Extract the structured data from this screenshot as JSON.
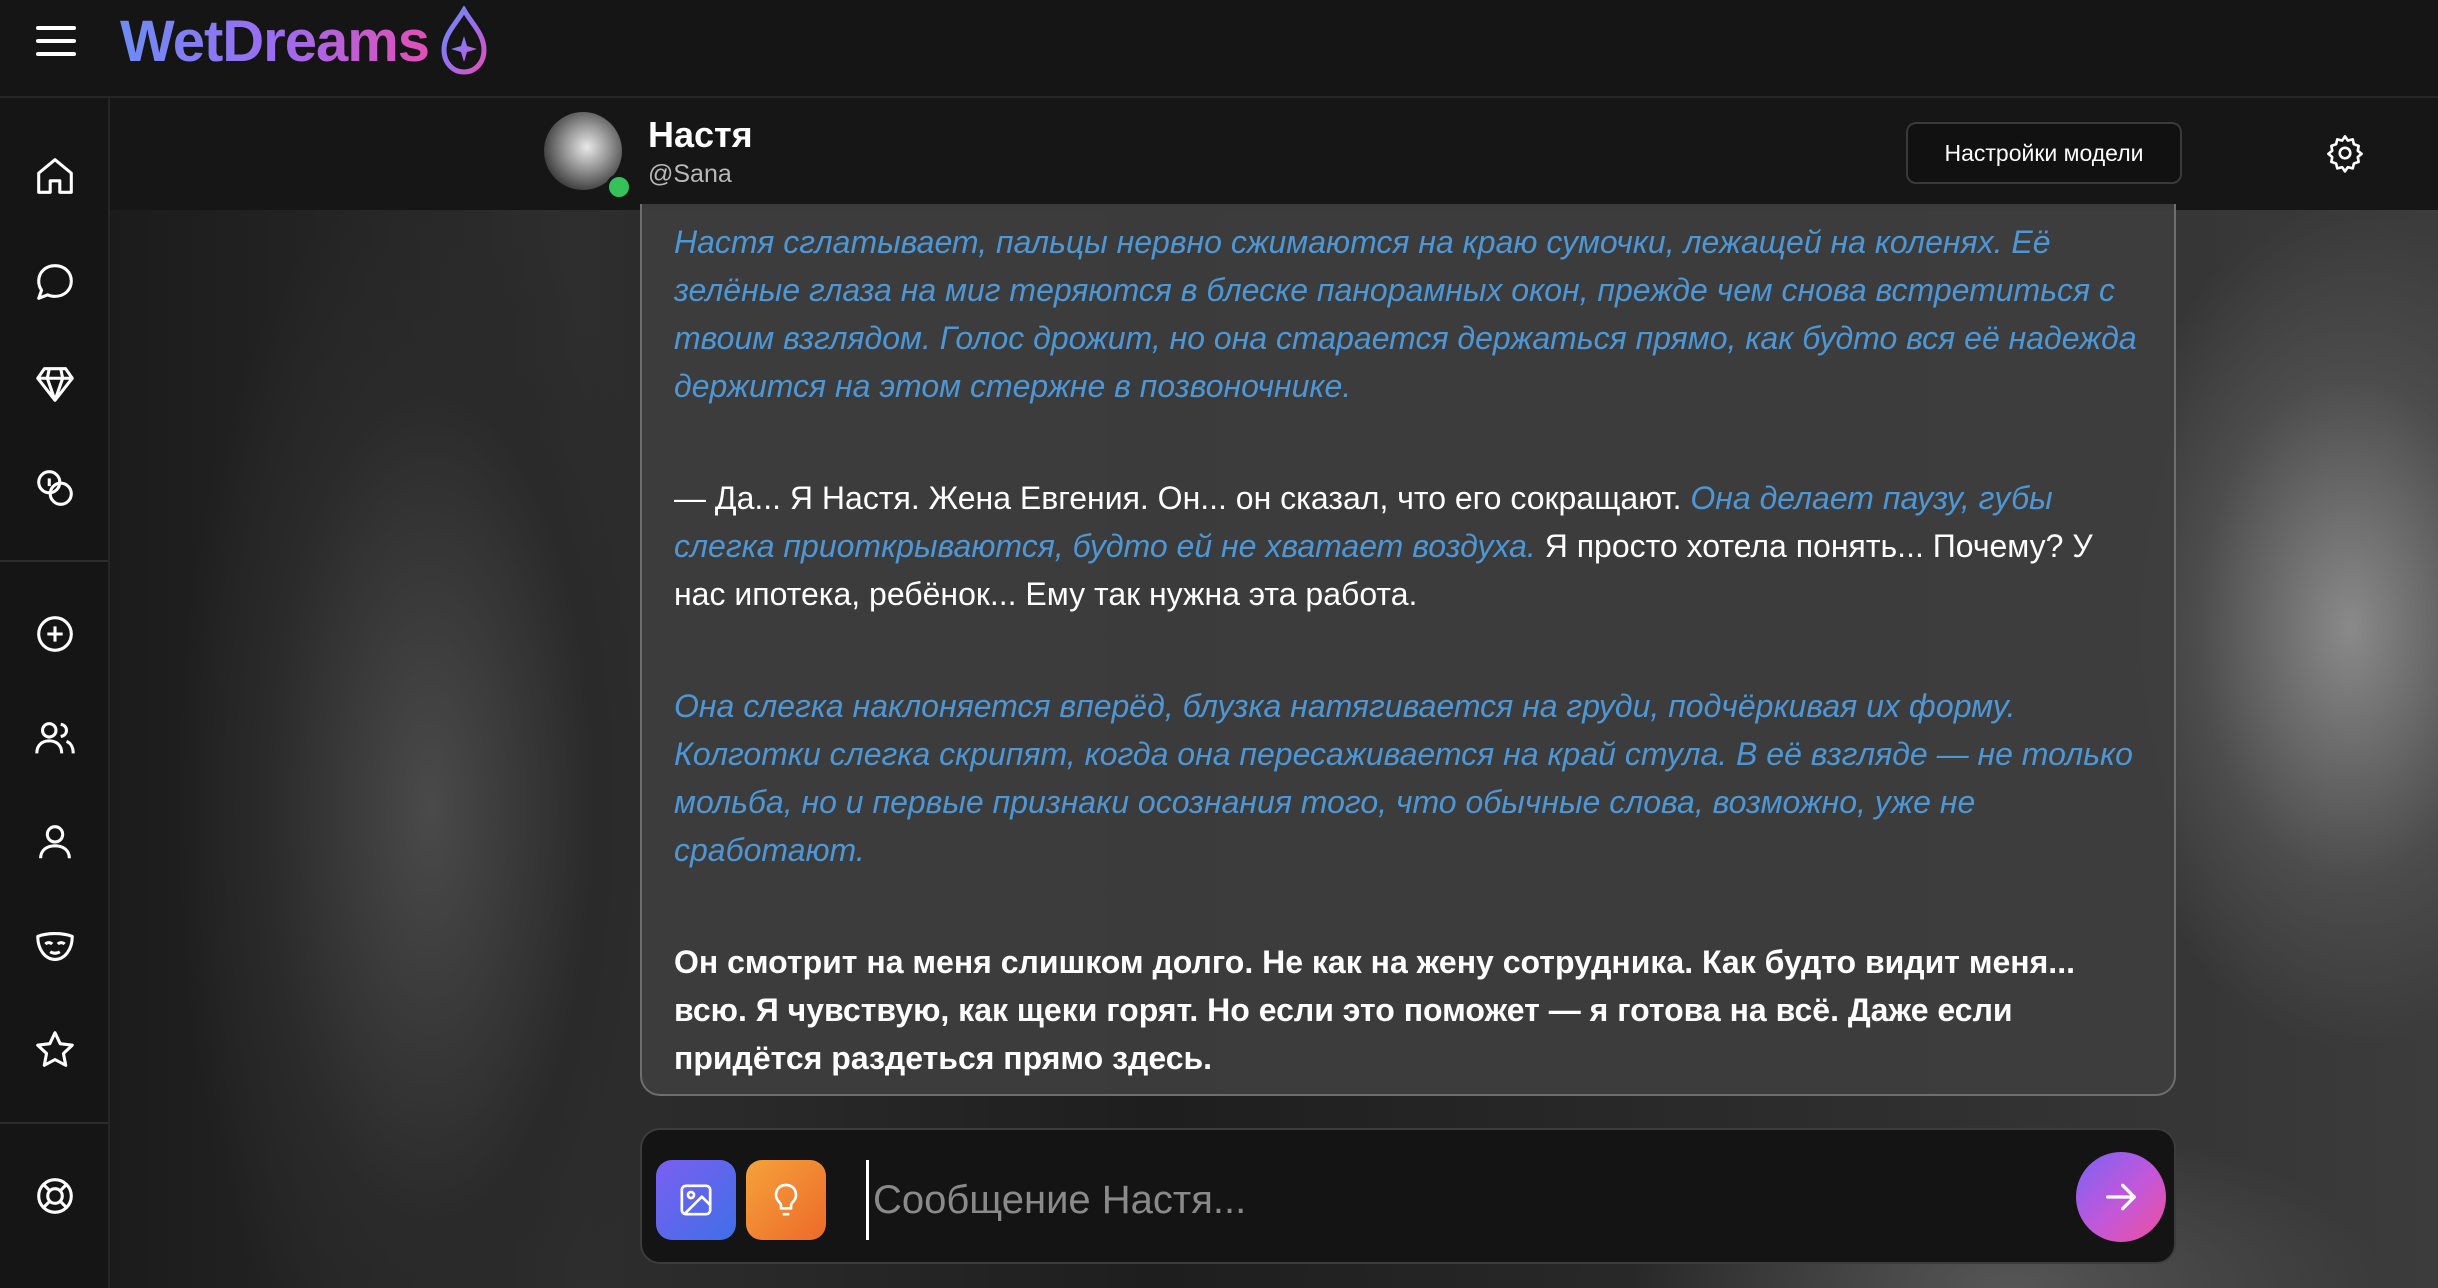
{
  "app": {
    "name": "WetDreams",
    "brand_gradient": [
      "#6e8cf3",
      "#9b6df0",
      "#e24fb5"
    ]
  },
  "topbar": {
    "menu_icon": "hamburger-menu-icon"
  },
  "sidebar": {
    "items": [
      {
        "id": "home",
        "icon": "home-icon"
      },
      {
        "id": "chats",
        "icon": "chat-bubble-icon"
      },
      {
        "id": "premium",
        "icon": "diamond-icon"
      },
      {
        "id": "coins",
        "icon": "coins-icon"
      },
      {
        "id": "create",
        "icon": "plus-circle-icon"
      },
      {
        "id": "community",
        "icon": "users-icon"
      },
      {
        "id": "profile",
        "icon": "user-icon"
      },
      {
        "id": "personas",
        "icon": "mask-icon"
      },
      {
        "id": "favorites",
        "icon": "star-icon"
      },
      {
        "id": "support",
        "icon": "lifebuoy-icon"
      }
    ]
  },
  "chat_header": {
    "name": "Настя",
    "handle": "@Sana",
    "online": true,
    "model_settings_label": "Настройки модели",
    "settings_icon": "gear-icon"
  },
  "message": {
    "p1": "Настя сглатывает, пальцы нервно сжимаются на краю сумочки, лежащей на коленях. Её зелёные глаза на миг теряются в блеске панорамных окон, прежде чем снова встретиться с твоим взглядом. Голос дрожит, но она старается держаться прямо, как будто вся её надежда держится на этом стержне в позвоночнике.",
    "p2_a": "— Да... Я Настя. Жена Евгения. Он... он сказал, что его сокращают.",
    "p2_b": "Она делает паузу, губы слегка приоткрываются, будто ей не хватает воздуха.",
    "p2_c": "Я просто хотела понять... Почему? У нас ипотека, ребёнок... Ему так нужна эта работа.",
    "p3": "Она слегка наклоняется вперёд, блузка натягивается на груди, подчёркивая их форму. Колготки слегка скрипят, когда она пересаживается на край стула. В её взгляде — не только мольба, но и первые признаки осознания того, что обычные слова, возможно, уже не сработают.",
    "p4": "Он смотрит на меня слишком долго. Не как на жену сотрудника. Как будто видит меня... всю. Я чувствую, как щеки горят. Но если это поможет — я готова на всё. Даже если придётся раздеться прямо здесь."
  },
  "composer": {
    "placeholder": "Сообщение Настя...",
    "value": "",
    "image_icon": "image-icon",
    "idea_icon": "lightbulb-icon",
    "send_icon": "arrow-right-icon"
  },
  "colors": {
    "narration": "#4d97d6",
    "online": "#36c25a",
    "send_gradient": [
      "#7a63f4",
      "#c457d8",
      "#ee4f9c"
    ]
  }
}
